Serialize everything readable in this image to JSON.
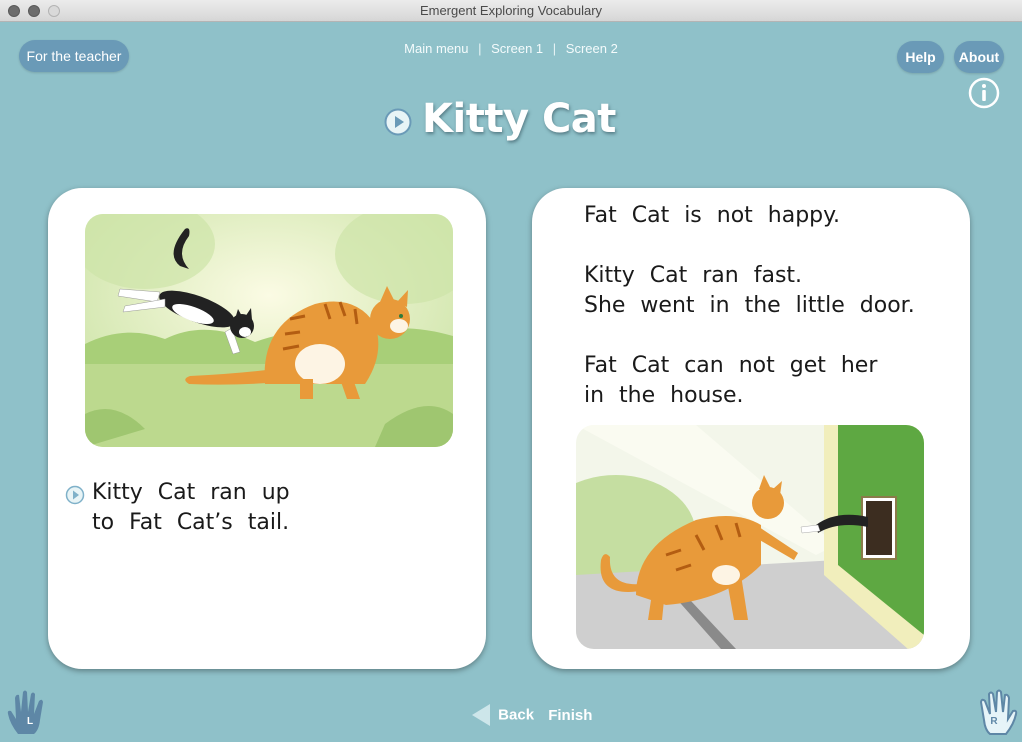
{
  "window": {
    "title": "Emergent Exploring Vocabulary"
  },
  "header": {
    "teacher_button": "For the teacher",
    "breadcrumb": {
      "main_menu": "Main menu",
      "sep": "|",
      "screen1": "Screen 1",
      "screen2": "Screen 2"
    },
    "help_button": "Help",
    "about_button": "About"
  },
  "page": {
    "title": "Kitty Cat"
  },
  "left_card": {
    "text": "Kitty Cat ran up\nto Fat Cat’s tail."
  },
  "right_card": {
    "para1": "Fat Cat is not happy.",
    "para2": "Kitty Cat ran fast.\nShe went in the little door.",
    "para3": "Fat Cat can not get her\nin the house."
  },
  "footer": {
    "back": "Back",
    "finish": "Finish",
    "left_hand_letter": "L",
    "right_hand_letter": "R"
  },
  "colors": {
    "background": "#8fc1c9",
    "pill": "#6a9ab7",
    "card": "#ffffff",
    "orange_cat": "#e89a3a",
    "grass": "#b7d98a"
  },
  "icons": [
    "play-icon",
    "info-icon",
    "left-hand-icon",
    "right-hand-icon",
    "back-arrow-icon"
  ]
}
